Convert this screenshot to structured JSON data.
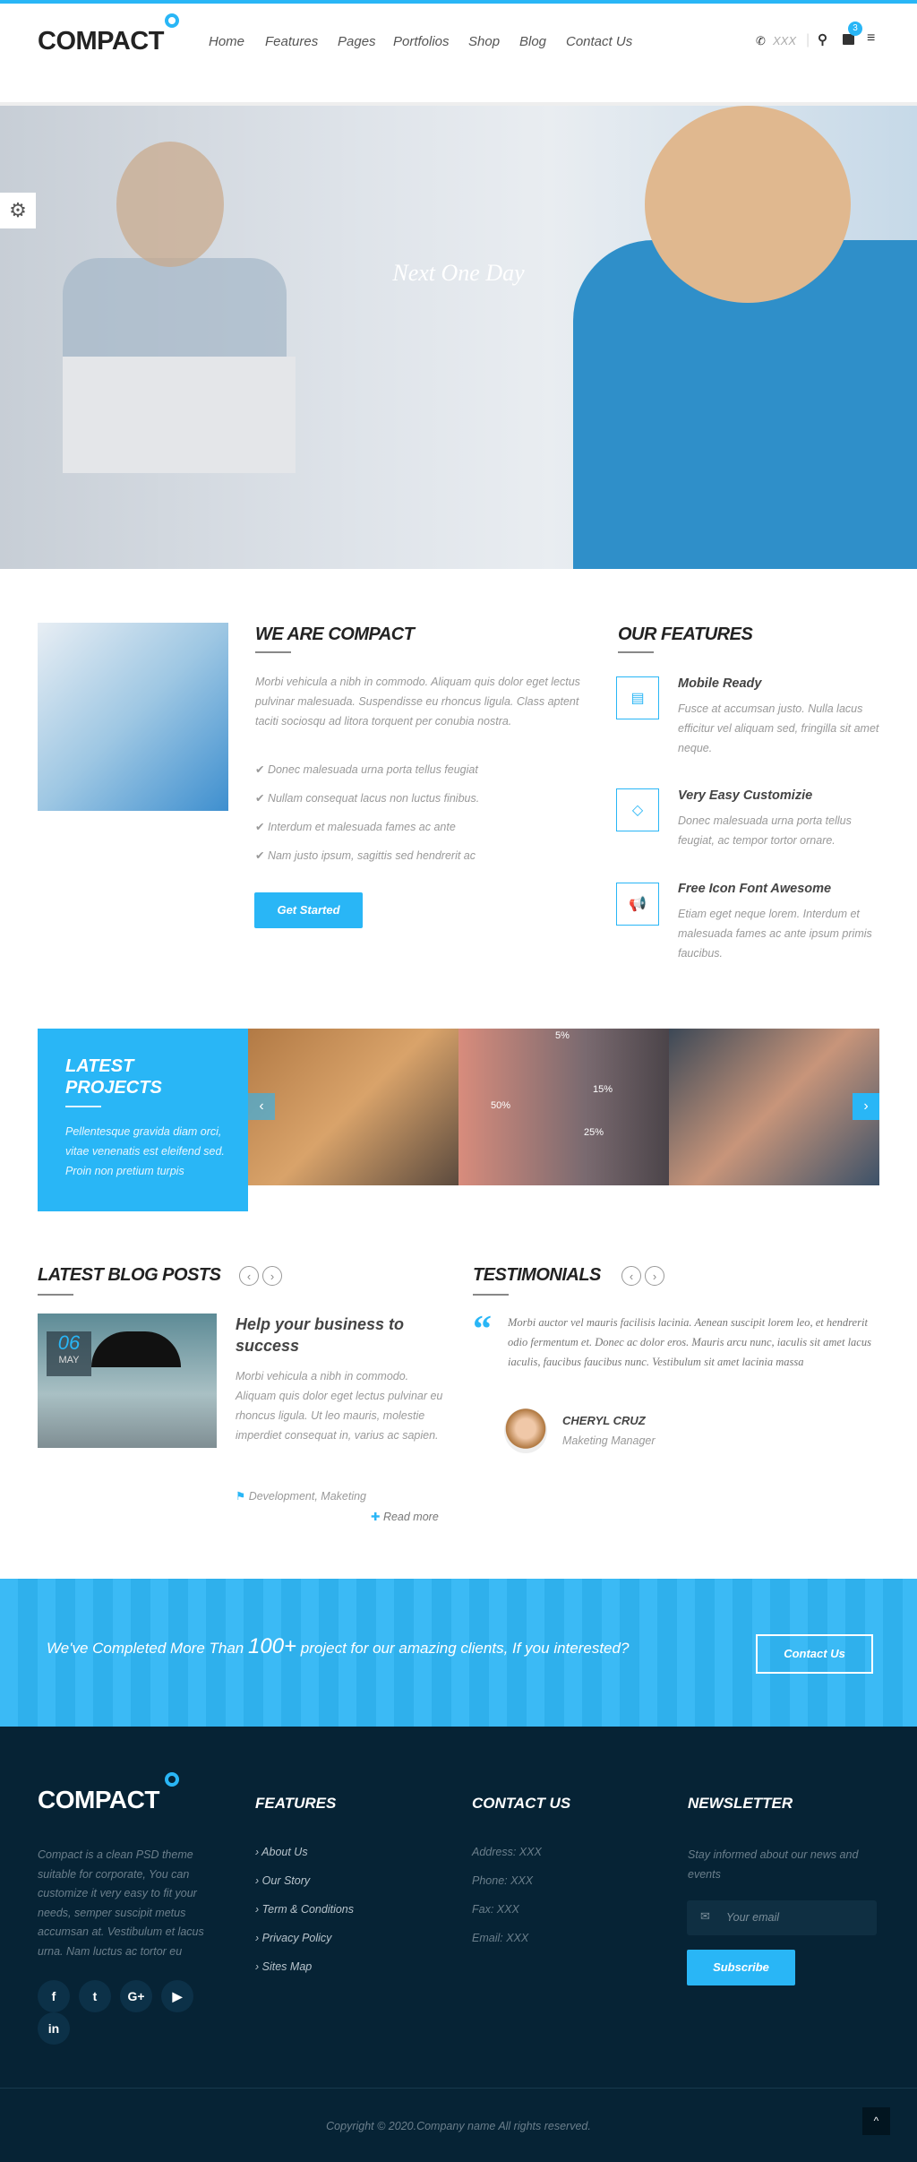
{
  "header": {
    "logo": "COMPACT",
    "nav": [
      "Home",
      "Features",
      "Pages",
      "Portfolios",
      "Shop",
      "Blog",
      "Contact Us"
    ],
    "phone": "XXX",
    "cart_count": "3"
  },
  "hero": {
    "title": "Next One Day"
  },
  "about": {
    "title": "WE ARE COMPACT",
    "text": "Morbi vehicula a nibh in commodo. Aliquam quis dolor eget lectus pulvinar malesuada. Suspendisse eu rhoncus ligula. Class aptent taciti sociosqu ad litora torquent per conubia nostra.",
    "list": [
      "Donec malesuada urna porta tellus feugiat",
      "Nullam consequat lacus non luctus finibus.",
      "Interdum et malesuada fames ac ante",
      "Nam justo ipsum, sagittis sed hendrerit ac"
    ],
    "button": "Get Started"
  },
  "features": {
    "title": "OUR FEATURES",
    "items": [
      {
        "icon": "bar-chart-icon",
        "title": "Mobile Ready",
        "text": "Fusce at accumsan justo. Nulla lacus efficitur vel aliquam sed, fringilla sit amet neque."
      },
      {
        "icon": "diamond-icon",
        "title": "Very Easy Customizie",
        "text": "Donec malesuada urna porta tellus feugiat, ac tempor tortor ornare."
      },
      {
        "icon": "bullhorn-icon",
        "title": "Free Icon Font Awesome",
        "text": "Etiam eget neque lorem. Interdum et malesuada fames ac ante ipsum primis faucibus."
      }
    ]
  },
  "projects": {
    "title": "LATEST PROJECTS",
    "text": "Pellentesque gravida diam orci, vitae venenatis est eleifend sed. Proin non pretium turpis",
    "chart_labels": [
      "5%",
      "15%",
      "50%",
      "25%"
    ]
  },
  "blog": {
    "title": "LATEST BLOG POSTS",
    "post": {
      "day": "06",
      "month": "MAY",
      "title": "Help your business to success",
      "text": "Morbi vehicula a nibh in commodo. Aliquam quis dolor eget lectus pulvinar eu rhoncus ligula. Ut leo mauris, molestie imperdiet consequat in, varius ac sapien.",
      "tags": "Development, Maketing",
      "read_more": "Read more"
    }
  },
  "testimonials": {
    "title": "TESTIMONIALS",
    "quote": "Morbi auctor vel mauris facilisis lacinia. Aenean suscipit lorem leo, et hendrerit odio fermentum et. Donec ac dolor eros. Mauris arcu nunc, iaculis sit amet lacus iaculis, faucibus faucibus nunc. Vestibulum sit amet lacinia massa",
    "name": "CHERYL CRUZ",
    "role": "Maketing Manager"
  },
  "cta": {
    "pre": "We've Completed More Than",
    "num": "100+",
    "post": "project for our amazing clients, If you interested?",
    "button": "Contact Us"
  },
  "footer": {
    "logo": "COMPACT",
    "about": "Compact is a clean PSD theme suitable for corporate, You can customize it very easy to fit your needs, semper suscipit metus accumsan at. Vestibulum et lacus urna. Nam luctus ac tortor eu",
    "features_title": "FEATURES",
    "links": [
      "About Us",
      "Our Story",
      "Term & Conditions",
      "Privacy Policy",
      "Sites Map"
    ],
    "contact_title": "CONTACT US",
    "contact": [
      "Address: XXX",
      "Phone: XXX",
      "Fax: XXX",
      "Email: XXX"
    ],
    "newsletter_title": "NEWSLETTER",
    "newsletter_text": "Stay informed about our news and events",
    "email_placeholder": "Your email",
    "subscribe": "Subscribe",
    "social": [
      "f",
      "t",
      "G+",
      "▶",
      "in"
    ],
    "copyright": "Copyright © 2020.Company name All rights reserved."
  },
  "colors": {
    "accent": "#29b6f6",
    "footer_bg": "#062335"
  }
}
